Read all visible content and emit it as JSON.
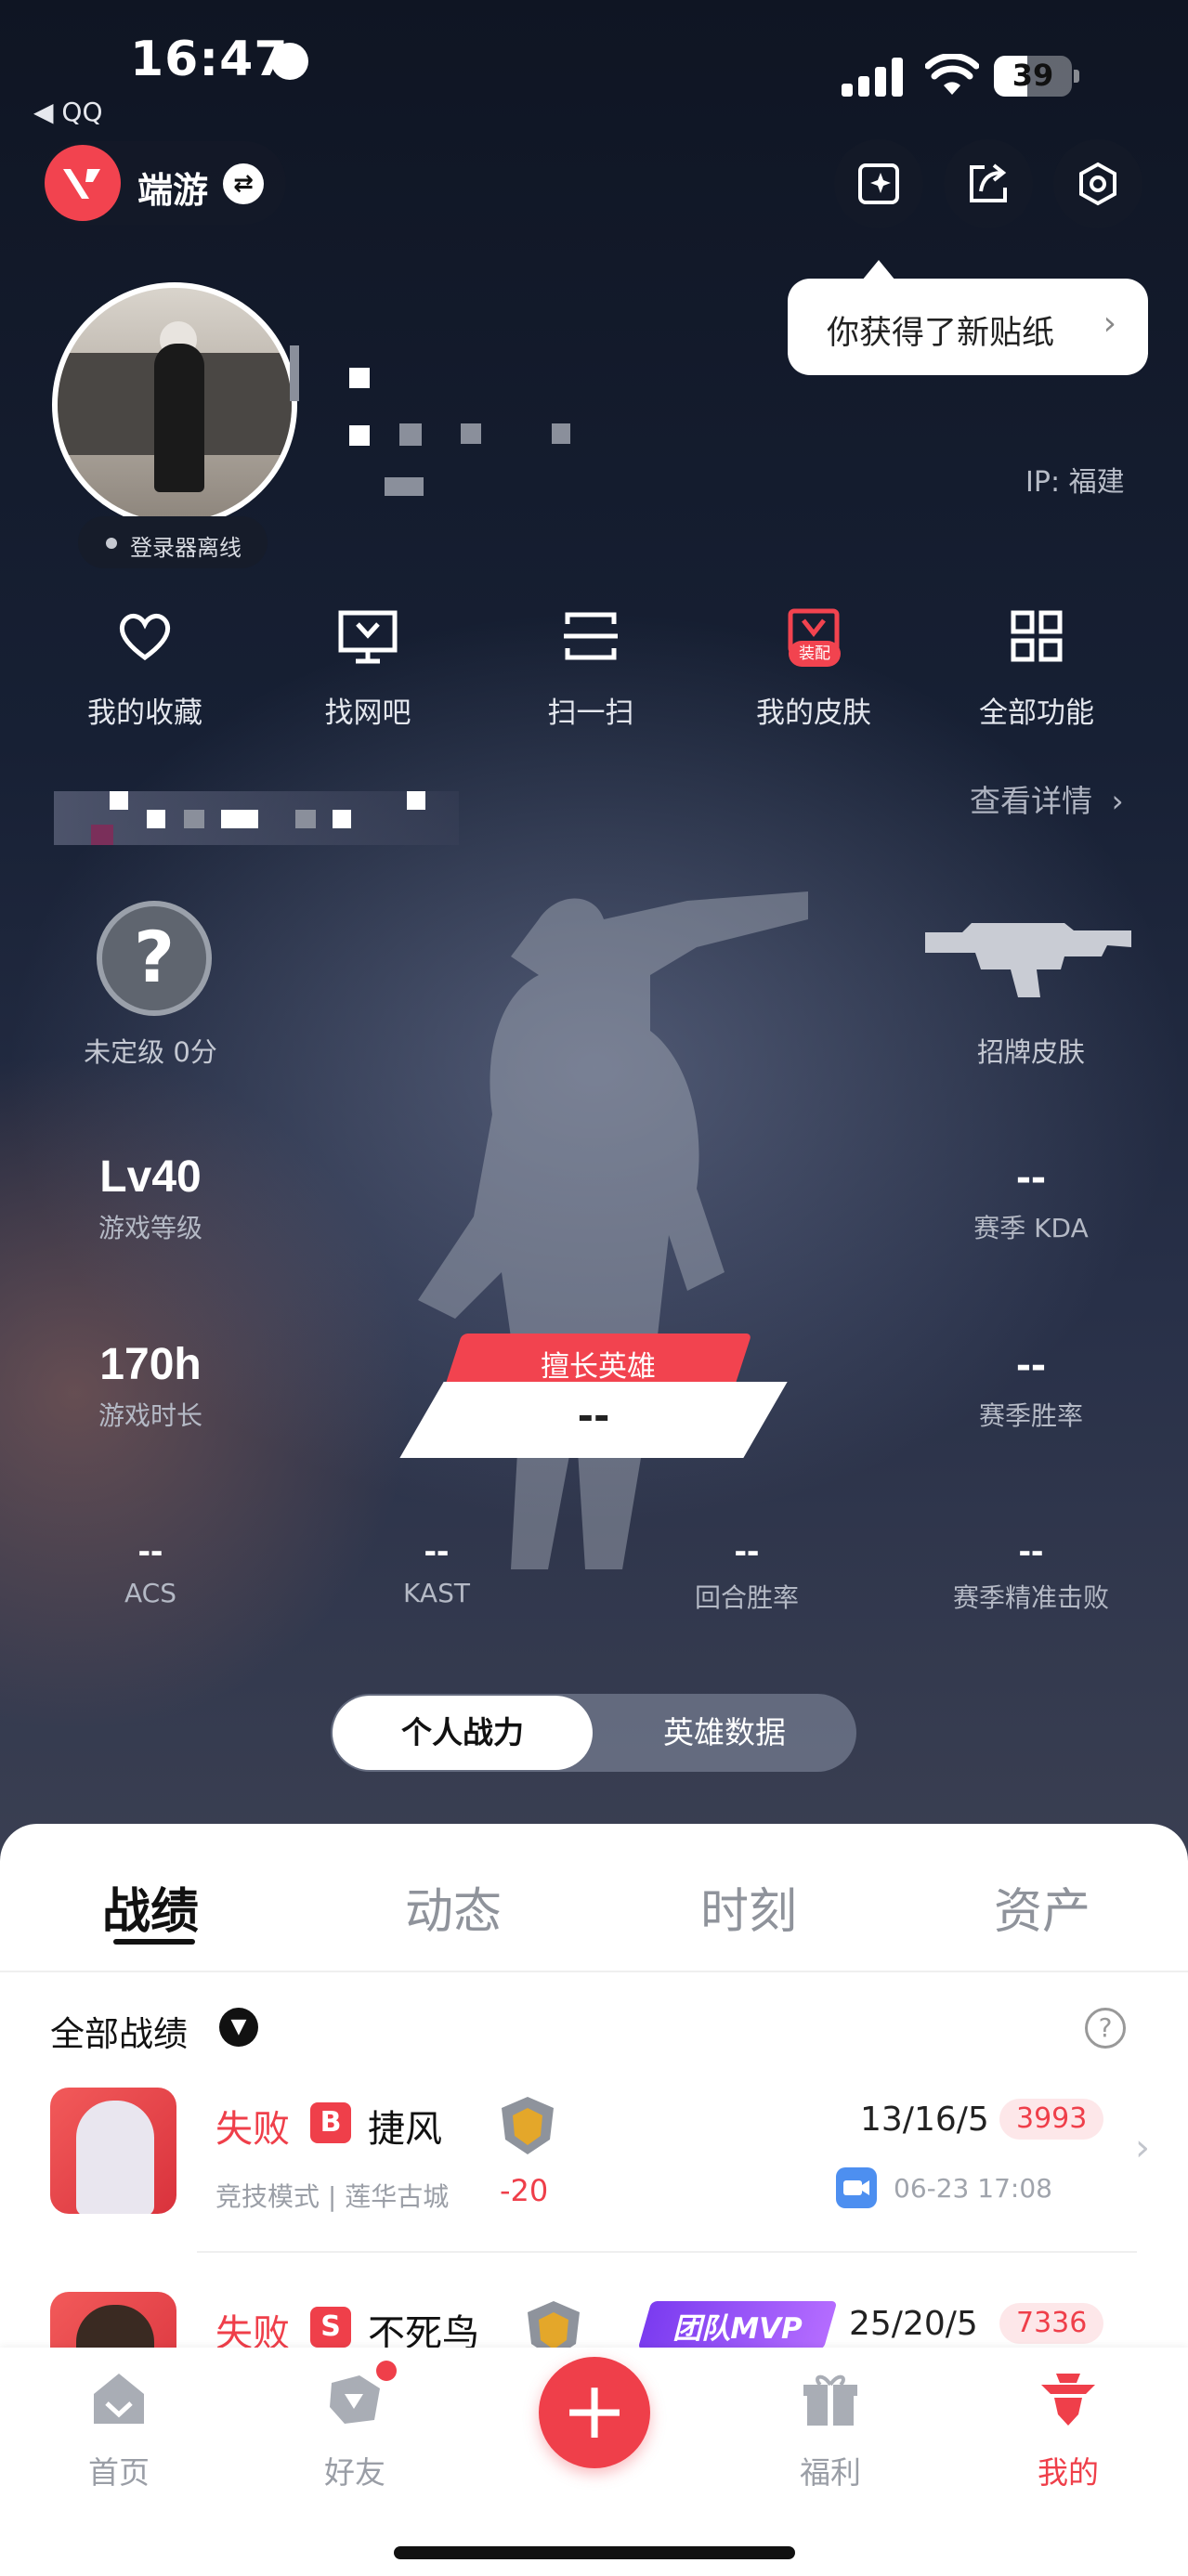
{
  "status_bar": {
    "time": "16:47",
    "back_app": "◀ QQ",
    "battery": "39"
  },
  "header": {
    "game_name": "端游",
    "tooltip": "你获得了新贴纸",
    "ip_label": "IP: 福建",
    "login_status": "登录器离线"
  },
  "features": [
    {
      "label": "我的收藏",
      "icon": "heart-icon"
    },
    {
      "label": "找网吧",
      "icon": "monitor-icon"
    },
    {
      "label": "扫一扫",
      "icon": "scan-icon"
    },
    {
      "label": "我的皮肤",
      "icon": "skin-icon",
      "badge": "装配"
    },
    {
      "label": "全部功能",
      "icon": "grid-icon"
    }
  ],
  "details_link": "查看详情",
  "rank": {
    "symbol": "?",
    "label": "未定级 0分"
  },
  "signature_skin": {
    "label": "招牌皮肤"
  },
  "stats": {
    "level": {
      "value": "Lv40",
      "label": "游戏等级"
    },
    "playtime": {
      "value": "170h",
      "label": "游戏时长"
    },
    "season_kda": {
      "value": "--",
      "label": "赛季 KDA"
    },
    "season_winrate": {
      "value": "--",
      "label": "赛季胜率"
    },
    "acs": {
      "value": "--",
      "label": "ACS"
    },
    "kast": {
      "value": "--",
      "label": "KAST"
    },
    "round_winrate": {
      "value": "--",
      "label": "回合胜率"
    },
    "headshot": {
      "value": "--",
      "label": "赛季精准击败"
    }
  },
  "best_hero": {
    "tag": "擅长英雄",
    "value": "--"
  },
  "segment": {
    "active": "个人战力",
    "inactive": "英雄数据"
  },
  "tabs": [
    "战绩",
    "动态",
    "时刻",
    "资产"
  ],
  "filter": "全部战绩",
  "matches": [
    {
      "result": "失败",
      "grade": "B",
      "agent": "捷风",
      "mode": "竞技模式 | 莲华古城",
      "delta": "-20",
      "kda": "13/16/5",
      "score": "3993",
      "time": "06-23 17:08"
    },
    {
      "result": "失败",
      "grade": "S",
      "agent": "不死鸟",
      "mvp": "团队MVP",
      "kda": "25/20/5",
      "score": "7336"
    }
  ],
  "nav": [
    {
      "label": "首页",
      "icon": "home-icon"
    },
    {
      "label": "好友",
      "icon": "friends-icon"
    },
    {
      "label": "",
      "icon": "plus-icon"
    },
    {
      "label": "福利",
      "icon": "gift-icon"
    },
    {
      "label": "我的",
      "icon": "profile-icon"
    }
  ],
  "colors": {
    "accent": "#ef3f4a",
    "panel": "#ffffff",
    "background": "#141a2b"
  }
}
